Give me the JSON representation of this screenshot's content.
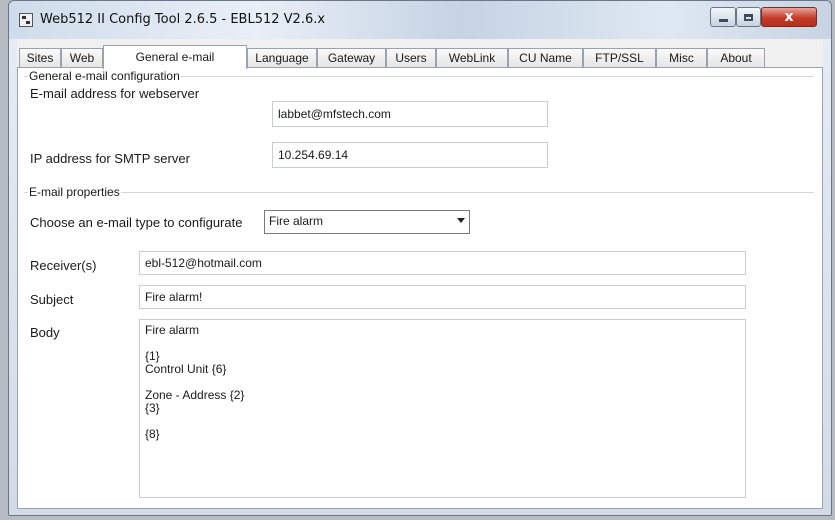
{
  "window": {
    "title": "Web512 II Config Tool 2.6.5 - EBL512 V2.6.x",
    "app_icon": "app-icon",
    "controls": {
      "minimize": "minimize-icon",
      "maximize": "maximize-icon",
      "close": "close-icon",
      "close_glyph": "x"
    }
  },
  "tabs": [
    {
      "label": "Sites"
    },
    {
      "label": "Web"
    },
    {
      "label": "General e-mail",
      "active": true
    },
    {
      "label": "Language"
    },
    {
      "label": "Gateway"
    },
    {
      "label": "Users"
    },
    {
      "label": "WebLink"
    },
    {
      "label": "CU Name"
    },
    {
      "label": "FTP/SSL"
    },
    {
      "label": "Misc"
    },
    {
      "label": "About"
    }
  ],
  "general": {
    "group_title": "General e-mail configuration",
    "email_label": "E-mail address for webserver",
    "email_value": "labbet@mfstech.com",
    "smtp_label": "IP address for SMTP server",
    "smtp_value": "10.254.69.14"
  },
  "properties": {
    "group_title": "E-mail properties",
    "type_label": "Choose an e-mail type to configurate",
    "type_selected": "Fire alarm",
    "receiver_label": "Receiver(s)",
    "receiver_value": "ebl-512@hotmail.com",
    "subject_label": "Subject",
    "subject_value": "Fire alarm!",
    "body_label": "Body",
    "body_value": "Fire alarm\n\n{1}\nControl Unit {6}\n\nZone - Address  {2}\n{3}\n\n{8}"
  }
}
